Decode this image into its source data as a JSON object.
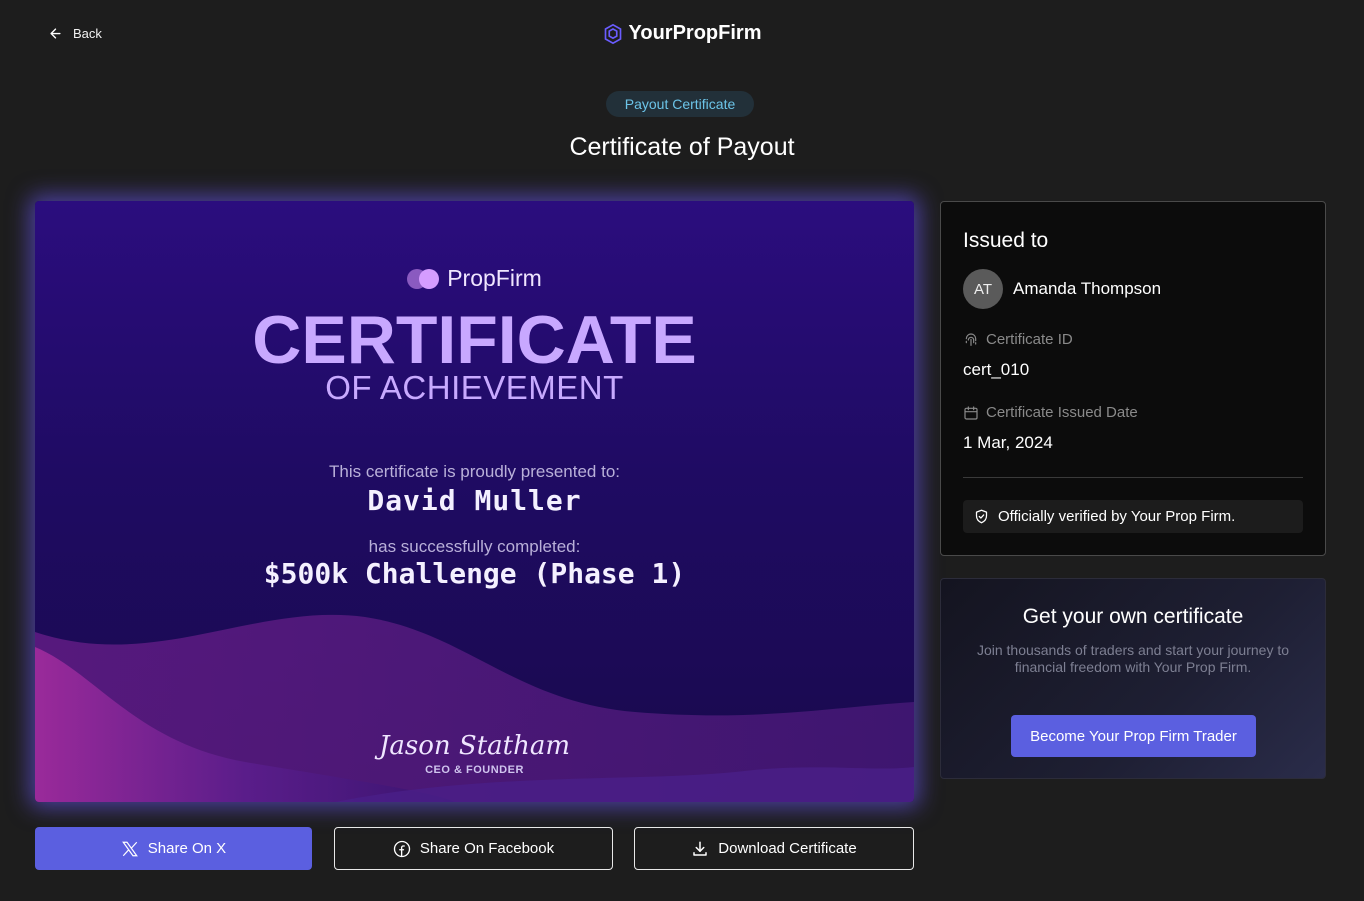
{
  "nav": {
    "back_label": "Back",
    "brand": "YourPropFirm"
  },
  "header": {
    "tag": "Payout Certificate",
    "title": "Certificate of Payout"
  },
  "certificate": {
    "brand": "PropFirm",
    "heading": "CERTIFICATE",
    "subheading": "OF ACHIEVEMENT",
    "presented_text": "This certificate is proudly presented to:",
    "recipient": "David Muller",
    "completed_text": "has successfully completed:",
    "challenge": "$500k Challenge (Phase 1)",
    "signature": "Jason Statham",
    "signer_role": "CEO & FOUNDER"
  },
  "actions": {
    "share_x": "Share On X",
    "share_facebook": "Share On Facebook",
    "download": "Download Certificate"
  },
  "issued": {
    "title": "Issued to",
    "avatar_initials": "AT",
    "name": "Amanda Thompson",
    "cert_id_label": "Certificate ID",
    "cert_id": "cert_010",
    "date_label": "Certificate Issued Date",
    "date": "1 Mar, 2024",
    "verified_text": "Officially verified by Your Prop Firm."
  },
  "promo": {
    "title": "Get your own certificate",
    "body": "Join thousands of traders and start your journey to financial freedom with Your Prop Firm.",
    "button": "Become Your Prop Firm Trader"
  },
  "colors": {
    "accent": "#5b5fe0",
    "tag_text": "#6cc4e8",
    "certificate_bg": "#2b0d7e",
    "certificate_heading": "#c8a8ff"
  },
  "icons": {
    "back": "arrow-left-icon",
    "brand": "hexagon-logo-icon",
    "x": "x-logo-icon",
    "facebook": "facebook-icon",
    "download": "download-icon",
    "cert_id": "fingerprint-icon",
    "date": "calendar-icon",
    "verified": "shield-check-icon"
  }
}
